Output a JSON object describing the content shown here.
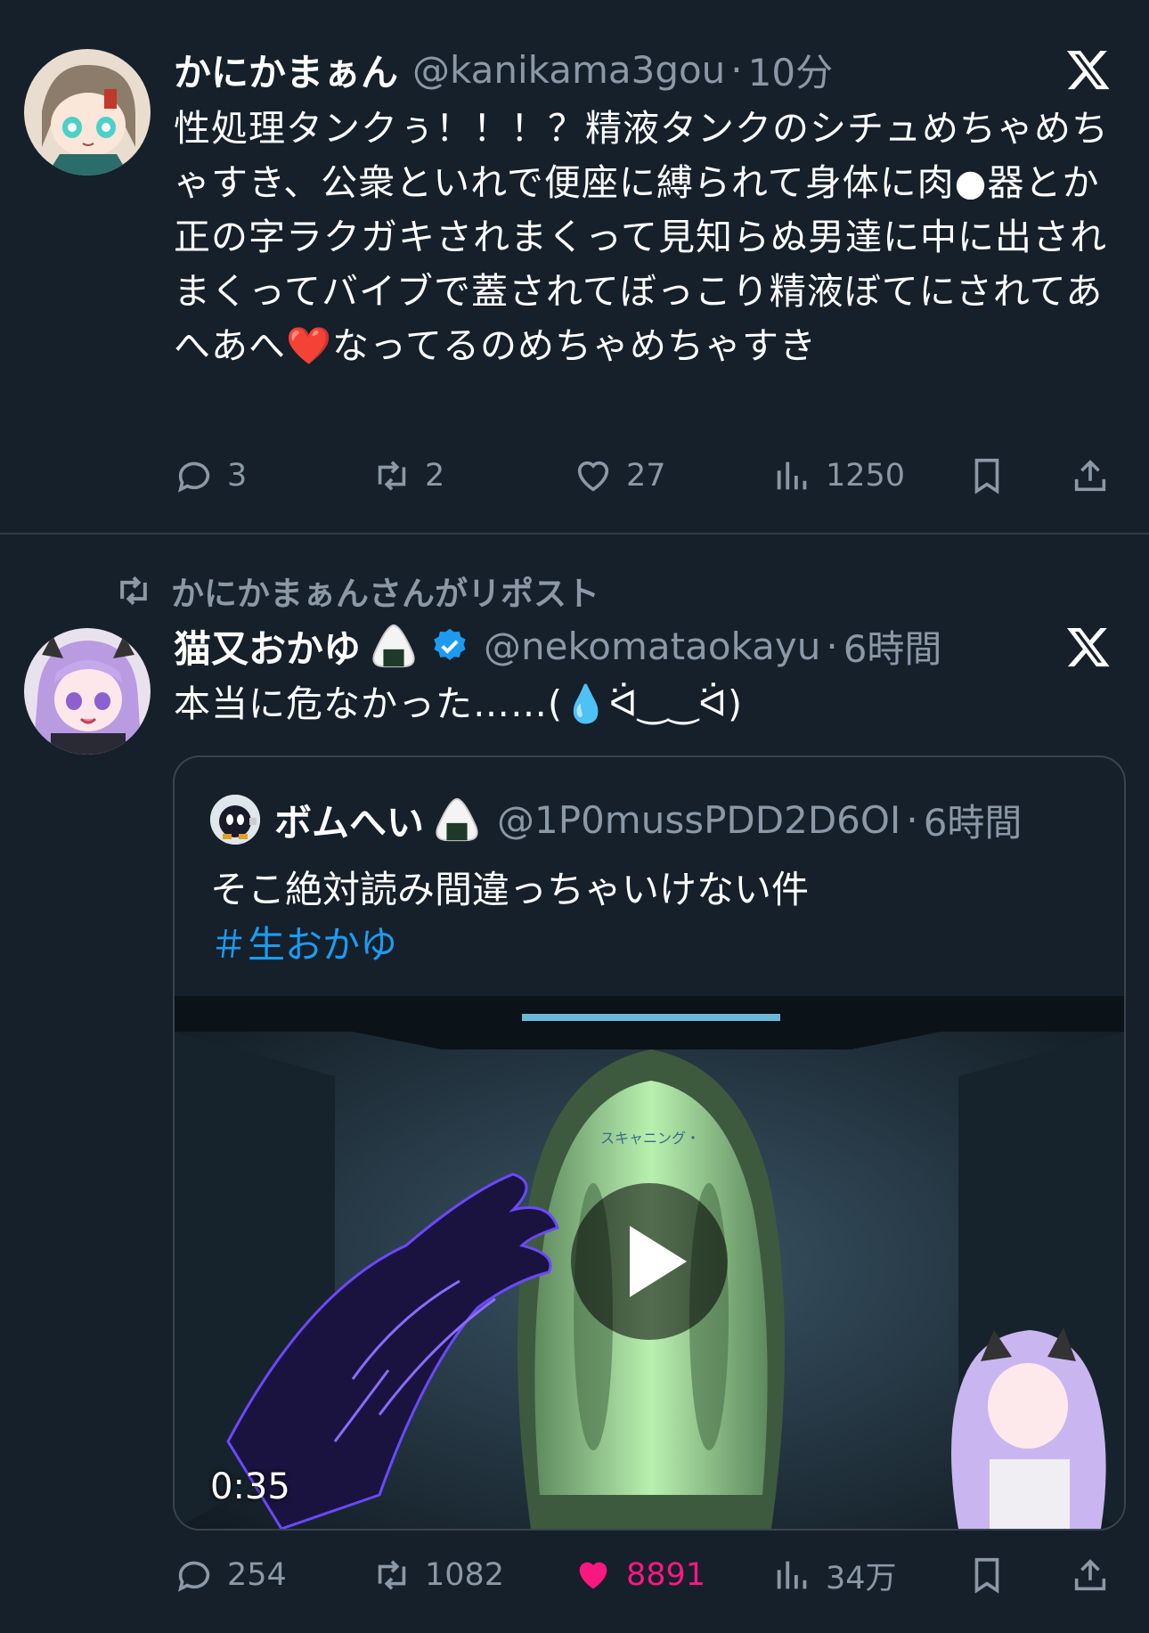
{
  "tweet1": {
    "name": "かにかまぁん",
    "handle": "@kanikama3gou",
    "dot": "·",
    "time": "10分",
    "text": "性処理タンクぅ！！！？精液タンクのシチュめちゃめちゃすき、公衆といれで便座に縛られて身体に肉●器とか正の字ラクガキされまくって見知らぬ男達に中に出されまくってバイブで蓋されてぼっこり精液ぼてにされてあへあへ❤️なってるのめちゃめちゃすき",
    "replies": "3",
    "retweets": "2",
    "likes": "27",
    "views": "1250"
  },
  "retweet_banner": "かにかまぁんさんがリポスト",
  "tweet2": {
    "name": "猫又おかゆ",
    "handle": "@nekomataokayu",
    "dot": "·",
    "time": "6時間",
    "text": "本当に危なかった……(💧ᐛ‿‿ᐛ)",
    "replies": "254",
    "retweets": "1082",
    "likes": "8891",
    "views": "34万",
    "like_color": "#f91880"
  },
  "quote": {
    "name": "ボムへい",
    "handle": "@1P0mussPDD2D6OI",
    "dot": "·",
    "time": "6時間",
    "text": "そこ絶対読み間違っちゃいけない件",
    "hashtag": "＃生おかゆ",
    "video_duration": "0:35",
    "video_hud_text": "スキャニング・"
  },
  "colors": {
    "background": "#15202b",
    "secondary_text": "#8b98a5",
    "link": "#1d9bf0",
    "like": "#f91880",
    "verified": "#1d9bf0"
  },
  "icons": [
    "x-logo-icon",
    "reply-icon",
    "retweet-icon",
    "like-icon",
    "views-icon",
    "bookmark-icon",
    "share-icon",
    "verified-badge-icon",
    "onigiri-emoji-icon",
    "play-icon"
  ]
}
